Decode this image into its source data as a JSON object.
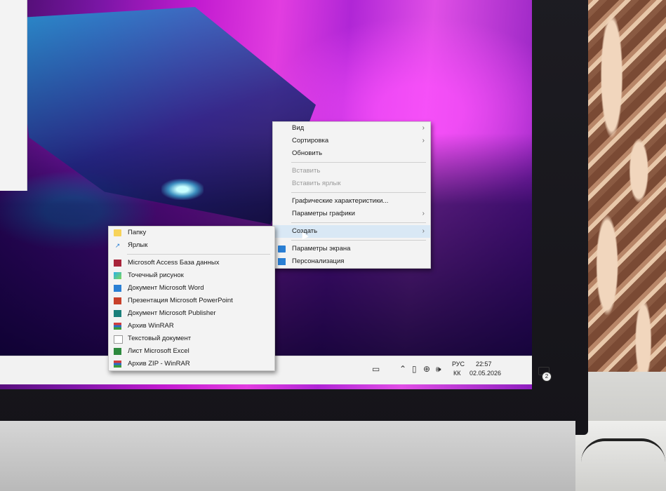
{
  "desktop_menu": {
    "items": [
      {
        "label": "Вид",
        "submenu": true,
        "disabled": false
      },
      {
        "label": "Сортировка",
        "submenu": true,
        "disabled": false
      },
      {
        "label": "Обновить",
        "submenu": false,
        "disabled": false
      },
      {
        "label": "Вставить",
        "submenu": false,
        "disabled": true
      },
      {
        "label": "Вставить ярлык",
        "submenu": false,
        "disabled": true
      },
      {
        "label": "Графические характеристики...",
        "submenu": false,
        "disabled": false
      },
      {
        "label": "Параметры графики",
        "submenu": true,
        "disabled": false
      },
      {
        "label": "Создать",
        "submenu": true,
        "disabled": false,
        "highlighted": true
      },
      {
        "label": "Параметры экрана",
        "icon": "display-settings-icon",
        "disabled": false
      },
      {
        "label": "Персонализация",
        "icon": "personalization-icon",
        "disabled": false
      }
    ]
  },
  "create_submenu": {
    "items": [
      {
        "label": "Папку",
        "icon": "folder-icon"
      },
      {
        "label": "Ярлык",
        "icon": "shortcut-icon"
      },
      {
        "label": "Microsoft Access База данных",
        "icon": "access-icon"
      },
      {
        "label": "Точечный рисунок",
        "icon": "bitmap-icon"
      },
      {
        "label": "Документ Microsoft Word",
        "icon": "word-icon"
      },
      {
        "label": "Презентация Microsoft PowerPoint",
        "icon": "powerpoint-icon"
      },
      {
        "label": "Документ Microsoft Publisher",
        "icon": "publisher-icon"
      },
      {
        "label": "Архив WinRAR",
        "icon": "winrar-icon"
      },
      {
        "label": "Текстовый документ",
        "icon": "text-document-icon"
      },
      {
        "label": "Лист Microsoft Excel",
        "icon": "excel-icon"
      },
      {
        "label": "Архив ZIP - WinRAR",
        "icon": "winrar-zip-icon"
      }
    ]
  },
  "taskbar": {
    "language_top": "РУС",
    "language_bottom": "КК",
    "time": "22:57",
    "date": "02.05.2026",
    "notification_count": "2"
  }
}
